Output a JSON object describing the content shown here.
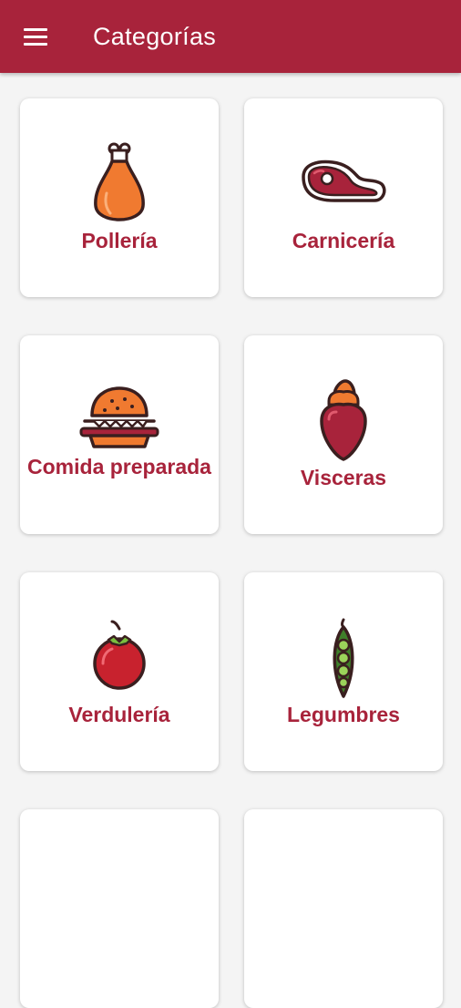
{
  "appbar": {
    "title": "Categorías",
    "menu_icon": "hamburger-menu-icon",
    "color": "#a8233b"
  },
  "categories": [
    {
      "label": "Pollería",
      "icon": "chicken-drumstick-icon"
    },
    {
      "label": "Carnicería",
      "icon": "steak-icon"
    },
    {
      "label": "Comida preparada",
      "icon": "burger-icon"
    },
    {
      "label": "Visceras",
      "icon": "offal-icon"
    },
    {
      "label": "Verdulería",
      "icon": "tomato-icon"
    },
    {
      "label": "Legumbres",
      "icon": "pea-pod-icon"
    }
  ]
}
